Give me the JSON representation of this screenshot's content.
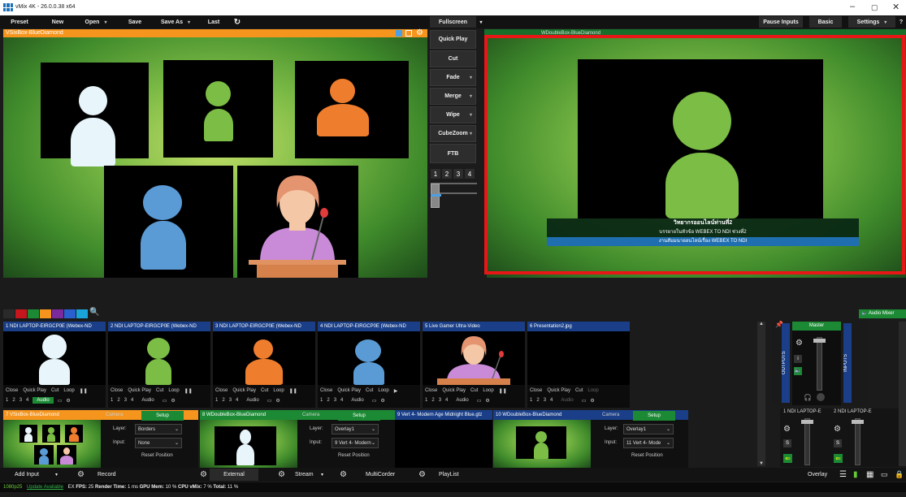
{
  "app": {
    "title": "vMix 4K - 26.0.0.38 x64"
  },
  "toolbar": {
    "preset": "Preset",
    "new": "New",
    "open": "Open",
    "save": "Save",
    "save_as": "Save As",
    "last": "Last",
    "fullscreen": "Fullscreen",
    "pause_inputs": "Pause Inputs",
    "basic": "Basic",
    "settings": "Settings",
    "help": "?"
  },
  "preview": {
    "title": "VSixBox-BlueDiamond"
  },
  "output": {
    "title": "WDoubleBox-BlueDiamond",
    "lower_third": {
      "line1": "วิทยากรออนไลน์ท่านที่2",
      "line2": "บรรยายในหัวข้อ WEBEX TO NDI ช่วงที่2",
      "line3": "งานสัมมนาออนไลน์เรื่อง WEBEX TO NDI"
    }
  },
  "transitions": {
    "quick_play": "Quick Play",
    "cut": "Cut",
    "fade": "Fade",
    "merge": "Merge",
    "wipe": "Wipe",
    "cubezoom": "CubeZoom",
    "ftb": "FTB",
    "numbers": [
      "1",
      "2",
      "3",
      "4"
    ]
  },
  "audio_mixer_label": "Audio Mixer",
  "inputs": [
    {
      "title": "1  NDI LAPTOP-EIRGCP0E (Webex-ND",
      "person_color": "#e8f6fb"
    },
    {
      "title": "2  NDI LAPTOP-EIRGCP0E (Webex-ND",
      "person_color": "#7cbd45"
    },
    {
      "title": "3  NDI LAPTOP-EIRGCP0E (Webex-ND",
      "person_color": "#ef7d2e"
    },
    {
      "title": "4  NDI LAPTOP-EIRGCP0E (Webex-ND",
      "person_color": "#5b9bd5"
    },
    {
      "title": "5  Live Gamer Ultra-Video"
    },
    {
      "title": "6  Presentation2.jpg"
    }
  ],
  "input_controls": {
    "close": "Close",
    "quick_play": "Quick Play",
    "cut": "Cut",
    "loop": "Loop",
    "audio": "Audio",
    "nums": [
      "1",
      "2",
      "3",
      "4"
    ]
  },
  "big_inputs": [
    {
      "title": "7  VSixBox-BlueDiamond",
      "camera": "Camera",
      "setup": "Setup",
      "layer_label": "Layer:",
      "layer": "Borders",
      "input_label": "Input:",
      "input": "None",
      "reset": "Reset Position"
    },
    {
      "title": "8  WDoubleBox-BlueDiamond",
      "camera": "Camera",
      "setup": "Setup",
      "layer_label": "Layer:",
      "layer": "Overlay1",
      "input_label": "Input:",
      "input": "9 Vert 4- Modern",
      "reset": "Reset Position"
    },
    {
      "title": "9  Vert 4- Modern Age Midnight Blue.gtz"
    },
    {
      "title": "10  WDoubleBox-BlueDiamond",
      "camera": "Camera",
      "setup": "Setup",
      "layer_label": "Layer:",
      "layer": "Overlay1",
      "input_label": "Input:",
      "input": "11 Vert 4- Mode",
      "reset": "Reset Position"
    }
  ],
  "mixer": {
    "master": "Master",
    "outputs": "OUTPUTS",
    "inputs": "INPUTS",
    "ch1": "1  NDI LAPTOP-E",
    "ch2": "2  NDI LAPTOP-E",
    "i": "i",
    "s": "S"
  },
  "bottom": {
    "add_input": "Add Input",
    "record": "Record",
    "external": "External",
    "stream": "Stream",
    "multicorder": "MultiCorder",
    "playlist": "PlayList",
    "overlay": "Overlay"
  },
  "status": {
    "resolution": "1080p25",
    "update": "Update Available",
    "ex": "EX",
    "fps_label": "FPS:",
    "fps": "25",
    "render_label": "Render Time:",
    "render": "1 ms",
    "gpu_label": "GPU Mem:",
    "gpu": "10 %",
    "cpu_label": "CPU vMix:",
    "cpu": "7 %",
    "total_label": "Total:",
    "total": "11 %"
  },
  "colors": {
    "accent_orange": "#f5951d",
    "accent_green": "#1c8a35",
    "highlight_red": "#e81616",
    "input_blue": "#1a3f88"
  }
}
